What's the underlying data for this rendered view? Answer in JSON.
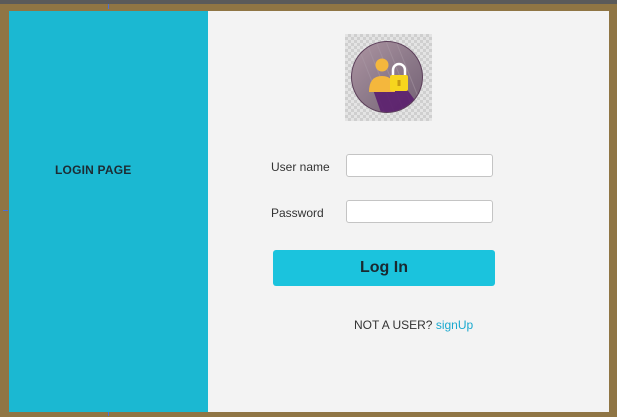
{
  "left_panel": {
    "title": "LOGIN PAGE"
  },
  "form": {
    "username_label": "User name",
    "username_value": "",
    "username_placeholder": "",
    "password_label": "Password",
    "password_value": "",
    "password_placeholder": "",
    "login_button": "Log In"
  },
  "signup": {
    "prompt": "NOT A USER?",
    "link": "signUp"
  },
  "icons": {
    "avatar": "user-lock-icon"
  },
  "colors": {
    "left_panel": "#1bb8d2",
    "right_panel": "#f3f3f3",
    "frame": "#8f7544",
    "button": "#1bc3dd",
    "link": "#1aa9cf"
  }
}
